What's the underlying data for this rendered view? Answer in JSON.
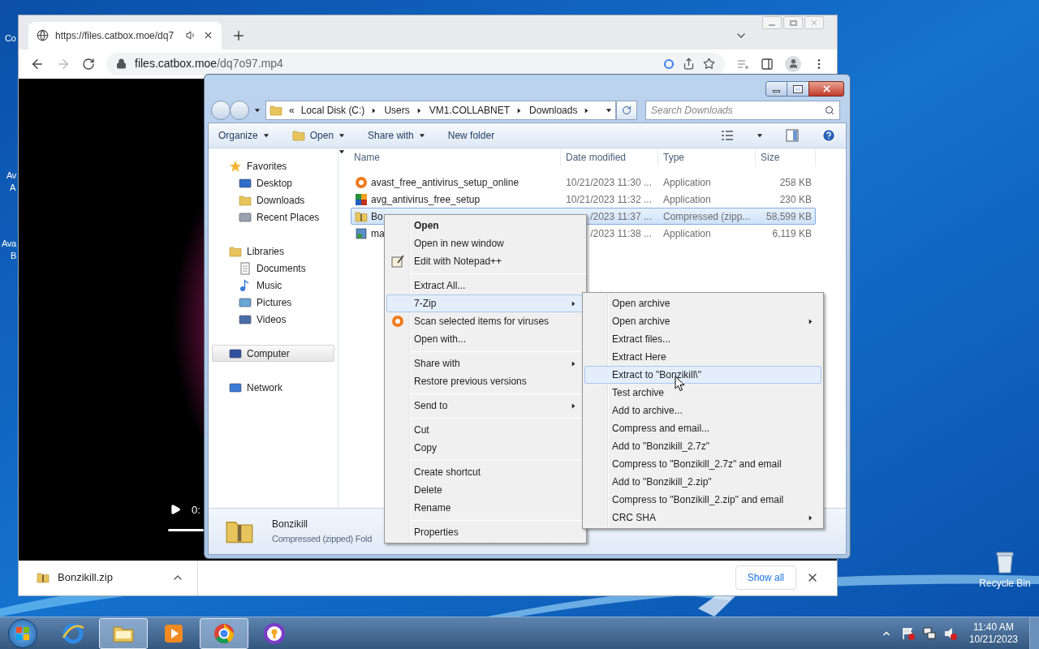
{
  "desktop": {
    "edge_labels": [
      "Co",
      "Av",
      "A",
      "Ava",
      "B"
    ],
    "recycle_bin": "Recycle Bin"
  },
  "browser": {
    "tab": {
      "title": "https://files.catbox.moe/dq7",
      "selected": true
    },
    "url": {
      "host": "files.catbox.moe",
      "path": "/dq7o97.mp4"
    },
    "video": {
      "time": "0:"
    },
    "download": {
      "file": "Bonzikill.zip",
      "show_all": "Show all"
    }
  },
  "explorer": {
    "path": [
      "Local Disk (C:)",
      "Users",
      "VM1.COLLABNET",
      "Downloads"
    ],
    "path_overflow": "«",
    "search_placeholder": "Search Downloads",
    "toolbar": [
      {
        "label": "Organize",
        "dropdown": true
      },
      {
        "label": "Open",
        "dropdown": true
      },
      {
        "label": "Share with",
        "dropdown": true
      },
      {
        "label": "New folder",
        "dropdown": false
      }
    ],
    "nav": [
      {
        "label": "Favorites",
        "selected": false,
        "children": [
          {
            "label": "Desktop",
            "selected": false
          },
          {
            "label": "Downloads",
            "selected": false
          },
          {
            "label": "Recent Places",
            "selected": false
          }
        ]
      },
      {
        "label": "Libraries",
        "selected": false,
        "children": [
          {
            "label": "Documents",
            "selected": false
          },
          {
            "label": "Music",
            "selected": false
          },
          {
            "label": "Pictures",
            "selected": false
          },
          {
            "label": "Videos",
            "selected": false
          }
        ]
      },
      {
        "label": "Computer",
        "selected": true
      },
      {
        "label": "Network",
        "selected": false
      }
    ],
    "columns": [
      "Name",
      "Date modified",
      "Type",
      "Size"
    ],
    "rows": [
      {
        "name": "avast_free_antivirus_setup_online",
        "date": "10/21/2023 11:30 ...",
        "type": "Application",
        "size": "258 KB",
        "selected": false
      },
      {
        "name": "avg_antivirus_free_setup",
        "date": "10/21/2023 11:32 ...",
        "type": "Application",
        "size": "230 KB",
        "selected": false
      },
      {
        "name": "Bo",
        "date": "/2023 11:37 ...",
        "type": "Compressed (zipp...",
        "size": "58,599 KB",
        "selected": true
      },
      {
        "name": "ma",
        "date": "/2023 11:38 ...",
        "type": "Application",
        "size": "6,119 KB",
        "selected": false
      }
    ],
    "details": {
      "name": "Bonzikill",
      "type": "Compressed (zipped) Fold"
    }
  },
  "context_menu": {
    "groups": [
      [
        {
          "label": "Open",
          "default": true,
          "submenu": false,
          "selected": false
        },
        {
          "label": "Open in new window",
          "default": false,
          "submenu": false,
          "selected": false
        },
        {
          "label": "Edit with Notepad++",
          "default": false,
          "submenu": false,
          "selected": false
        }
      ],
      [
        {
          "label": "Extract All...",
          "default": false,
          "submenu": false,
          "selected": false
        },
        {
          "label": "7-Zip",
          "default": false,
          "submenu": true,
          "selected": true
        },
        {
          "label": "Scan selected items for viruses",
          "default": false,
          "submenu": false,
          "selected": false
        },
        {
          "label": "Open with...",
          "default": false,
          "submenu": false,
          "selected": false
        }
      ],
      [
        {
          "label": "Share with",
          "default": false,
          "submenu": true,
          "selected": false
        },
        {
          "label": "Restore previous versions",
          "default": false,
          "submenu": false,
          "selected": false
        }
      ],
      [
        {
          "label": "Send to",
          "default": false,
          "submenu": true,
          "selected": false
        }
      ],
      [
        {
          "label": "Cut",
          "default": false,
          "submenu": false,
          "selected": false
        },
        {
          "label": "Copy",
          "default": false,
          "submenu": false,
          "selected": false
        }
      ],
      [
        {
          "label": "Create shortcut",
          "default": false,
          "submenu": false,
          "selected": false
        },
        {
          "label": "Delete",
          "default": false,
          "submenu": false,
          "selected": false
        },
        {
          "label": "Rename",
          "default": false,
          "submenu": false,
          "selected": false
        }
      ],
      [
        {
          "label": "Properties",
          "default": false,
          "submenu": false,
          "selected": false
        }
      ]
    ]
  },
  "submenu": {
    "items": [
      {
        "label": "Open archive",
        "submenu": false,
        "selected": false
      },
      {
        "label": "Open archive",
        "submenu": true,
        "selected": false
      },
      {
        "label": "Extract files...",
        "submenu": false,
        "selected": false
      },
      {
        "label": "Extract Here",
        "submenu": false,
        "selected": false
      },
      {
        "label": "Extract to \"Bonzikill\\\"",
        "submenu": false,
        "selected": true
      },
      {
        "label": "Test archive",
        "submenu": false,
        "selected": false
      },
      {
        "label": "Add to archive...",
        "submenu": false,
        "selected": false
      },
      {
        "label": "Compress and email...",
        "submenu": false,
        "selected": false
      },
      {
        "label": "Add to \"Bonzikill_2.7z\"",
        "submenu": false,
        "selected": false
      },
      {
        "label": "Compress to \"Bonzikill_2.7z\" and email",
        "submenu": false,
        "selected": false
      },
      {
        "label": "Add to \"Bonzikill_2.zip\"",
        "submenu": false,
        "selected": false
      },
      {
        "label": "Compress to \"Bonzikill_2.zip\" and email",
        "submenu": false,
        "selected": false
      },
      {
        "label": "CRC SHA",
        "submenu": true,
        "selected": false
      }
    ]
  },
  "taskbar": {
    "apps": [
      {
        "active": false
      },
      {
        "active": true
      },
      {
        "active": false
      },
      {
        "active": true
      },
      {
        "active": false
      }
    ],
    "clock": {
      "time": "11:40 AM",
      "date": "10/21/2023"
    }
  }
}
